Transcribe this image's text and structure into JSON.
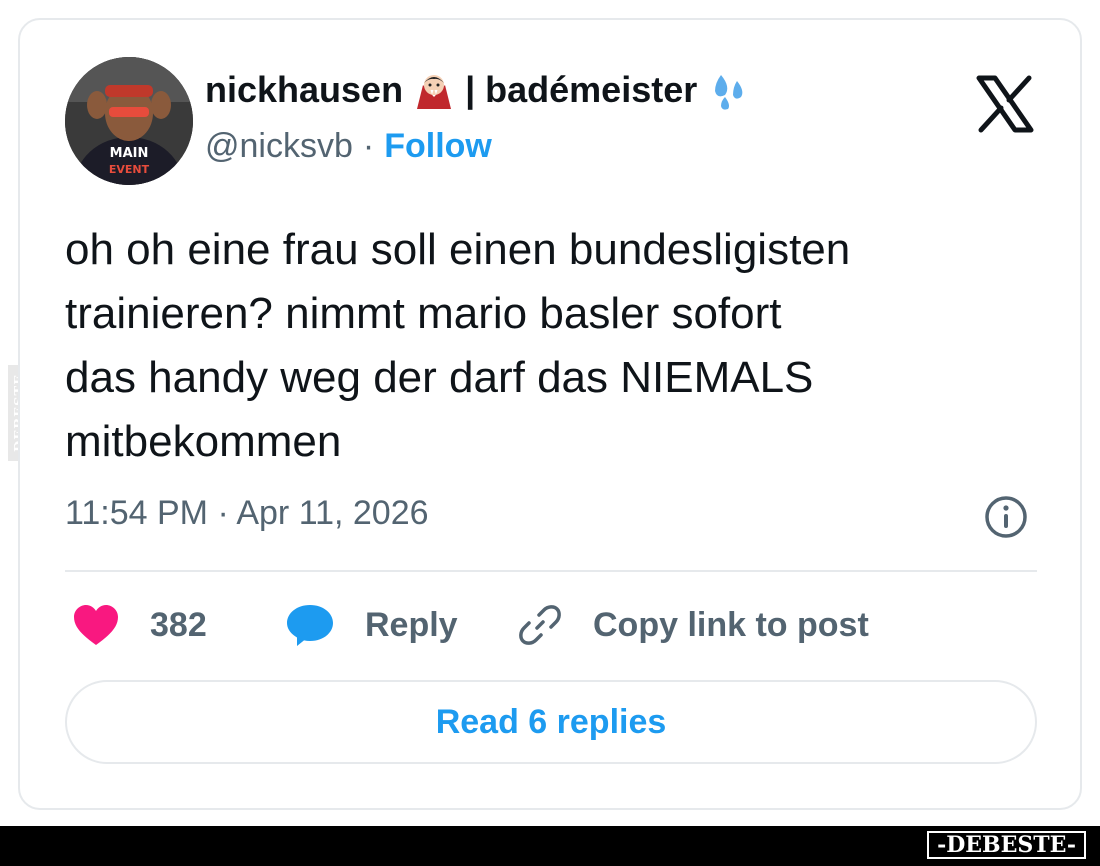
{
  "watermark": {
    "side_text": "DEBESTE",
    "footer_logo": "-DEBESTE-"
  },
  "author": {
    "display_name": "nickhausen",
    "display_name_suffix": "| badémeister",
    "name_emojis": [
      "vampire-emoji",
      "sweat-droplets-emoji"
    ],
    "handle": "@nicksvb",
    "separator": "·",
    "follow_label": "Follow"
  },
  "platform_logo": "x-logo",
  "tweet": {
    "text": "oh oh eine frau soll einen bundesligisten\ntrainieren? nimmt mario basler sofort\ndas handy weg der darf das NIEMALS\nmitbekommen",
    "timestamp": "11:54 PM · Apr 11, 2026"
  },
  "actions": {
    "like_count": "382",
    "reply_label": "Reply",
    "copy_label": "Copy link to post"
  },
  "read_replies_label": "Read 6 replies",
  "colors": {
    "accent": "#1d9bf0",
    "heart": "#f91880",
    "text_primary": "#0f1419",
    "text_secondary": "#536471",
    "border": "#e6e9ec"
  }
}
